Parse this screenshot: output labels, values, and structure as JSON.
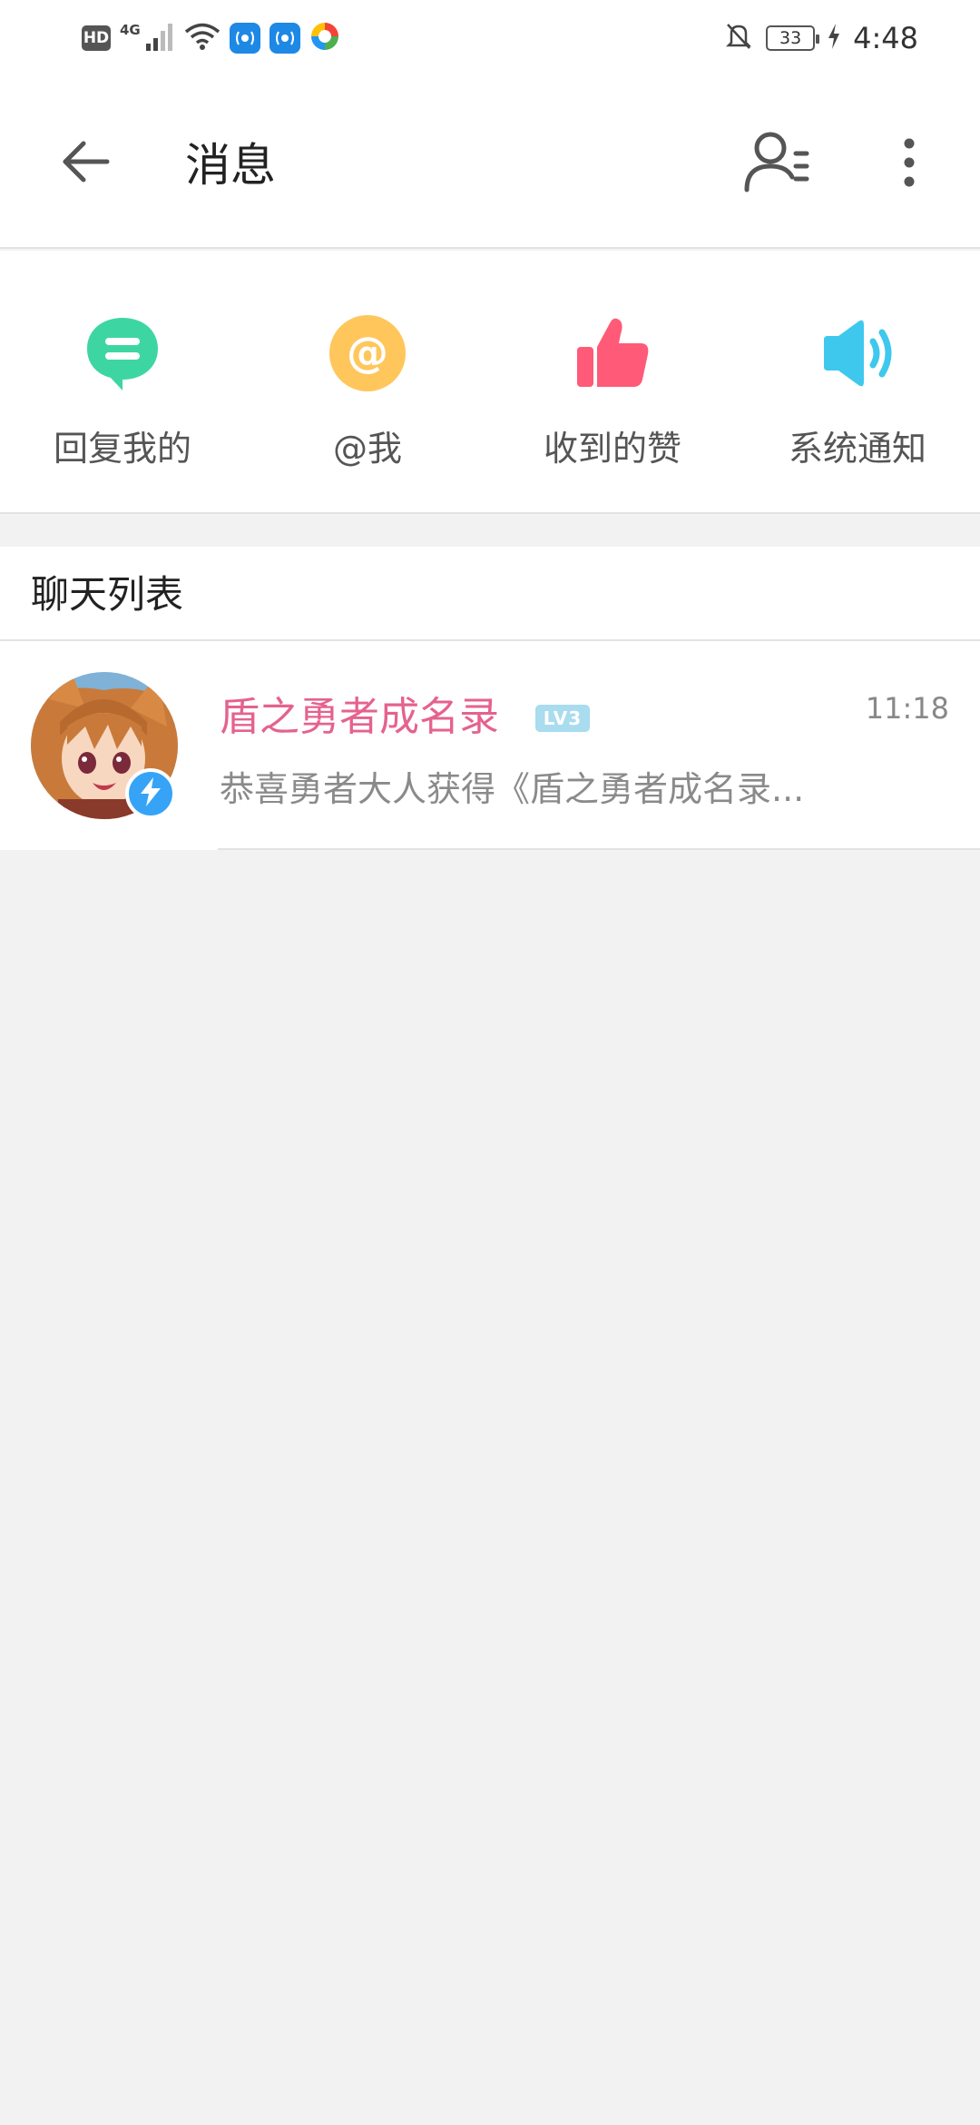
{
  "status_bar": {
    "hd": "HD",
    "network": "4G",
    "battery_level": "33",
    "time": "4:48",
    "icons": [
      "hd-icon",
      "cellular-signal-icon",
      "wifi-icon",
      "app-notification-icon",
      "app-notification-icon",
      "app-notification-icon",
      "bell-muted-icon",
      "battery-icon",
      "charging-icon"
    ]
  },
  "header": {
    "title": "消息",
    "back_icon": "arrow-left-icon",
    "contacts_icon": "contacts-list-icon",
    "more_icon": "more-vertical-icon"
  },
  "quick_entries": [
    {
      "label": "回复我的",
      "icon": "reply-bubble-icon",
      "color": "#3dd6a3"
    },
    {
      "label": "@我",
      "icon": "at-icon",
      "color": "#ffc65c"
    },
    {
      "label": "收到的赞",
      "icon": "thumbs-up-icon",
      "color": "#ff5a77"
    },
    {
      "label": "系统通知",
      "icon": "speaker-icon",
      "color": "#3fc8ee"
    }
  ],
  "chat_list": {
    "title": "聊天列表",
    "items": [
      {
        "name": "盾之勇者成名录",
        "level": "LV3",
        "time": "11:18",
        "preview": "恭喜勇者大人获得《盾之勇者成名录..."
      }
    ]
  },
  "colors": {
    "accent_pink": "#e5628e",
    "background": "#f2f2f2",
    "verified_blue": "#36a3f7"
  }
}
